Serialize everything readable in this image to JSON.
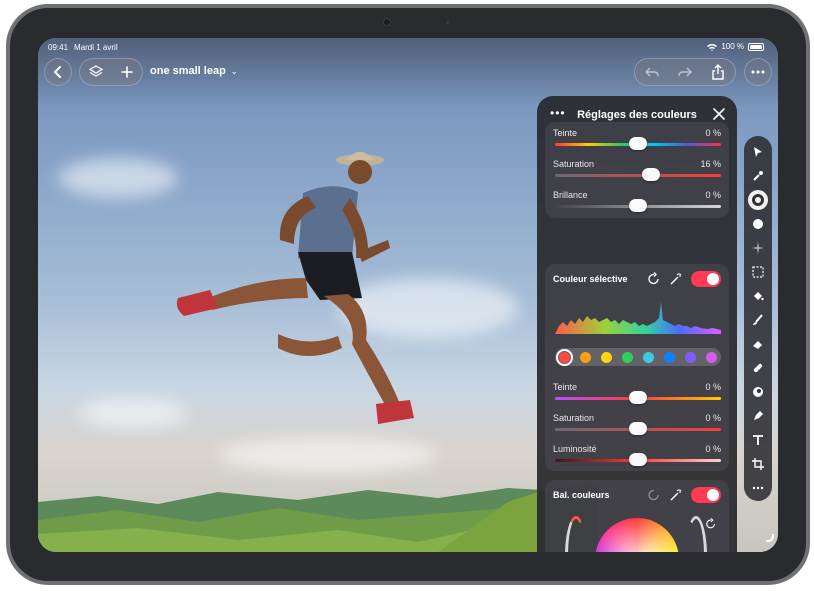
{
  "status_bar": {
    "time": "09:41",
    "date": "Mardi 1 avril",
    "battery": "100 %"
  },
  "toolbar": {
    "document_name": "one small leap"
  },
  "panel": {
    "title": "Réglages des couleurs",
    "top_section": {
      "rows": [
        {
          "label": "Teinte",
          "value": "0 %",
          "level": 0.5
        },
        {
          "label": "Saturation",
          "value": "16 %",
          "level": 0.58
        },
        {
          "label": "Brillance",
          "value": "0 %",
          "level": 0.5
        }
      ]
    },
    "selective_color": {
      "title": "Couleur sélective",
      "swatches": [
        "#ff4a3d",
        "#ff9f0a",
        "#ffd60a",
        "#30d158",
        "#40c8e0",
        "#0a84ff",
        "#7d5cff",
        "#d55cf0"
      ],
      "selected_swatch": 0,
      "rows": [
        {
          "label": "Teinte",
          "value": "0 %",
          "level": 0.5
        },
        {
          "label": "Saturation",
          "value": "0 %",
          "level": 0.5
        },
        {
          "label": "Luminosité",
          "value": "0 %",
          "level": 0.5
        }
      ]
    },
    "color_balance": {
      "title": "Bal. couleurs"
    }
  },
  "colors": {
    "accent_toggle": "#ff3b53",
    "panel_bg": "#2c2c30"
  },
  "icons": {
    "back": "chevron-left-icon",
    "layers": "layers-icon",
    "add": "plus-icon",
    "undo": "undo-icon",
    "redo": "redo-icon",
    "share": "share-icon",
    "more": "ellipsis-icon"
  }
}
